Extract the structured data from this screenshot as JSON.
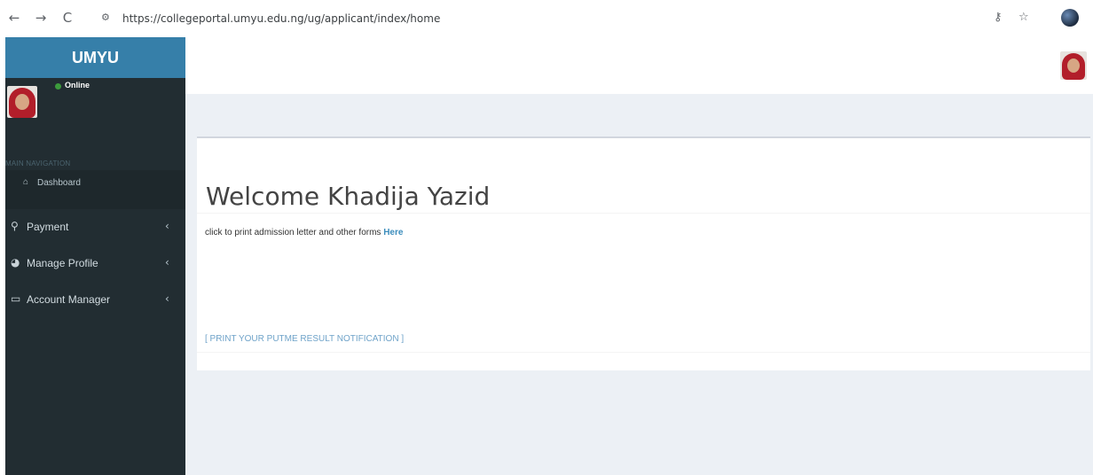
{
  "browser": {
    "url": "https://collegeportal.umyu.edu.ng/ug/applicant/index/home",
    "back_icon": "←",
    "forward_icon": "→",
    "reload_icon": "C",
    "site_info_icon": "⚙",
    "key_icon": "⚷",
    "star_icon": "☆"
  },
  "sidebar": {
    "logo": "UMYU",
    "status": "Online",
    "nav_header": "MAIN NAVIGATION",
    "dashboard": {
      "icon": "⌂",
      "label": "Dashboard"
    },
    "items": [
      {
        "icon": "⚲",
        "label": "Payment",
        "arrow": "‹"
      },
      {
        "icon": "◕",
        "label": "Manage Profile",
        "arrow": "‹"
      },
      {
        "icon": "▭",
        "label": "Account Manager",
        "arrow": "‹"
      }
    ]
  },
  "main": {
    "welcome": "Welcome Khadija Yazid",
    "print_text": "click to print admission letter and other forms",
    "print_link": "Here",
    "putme_link": "[ PRINT YOUR PUTME RESULT NOTIFICATION ]"
  },
  "colors": {
    "logo_bg": "#367fa9",
    "sidebar_bg": "#222d32",
    "content_bg": "#ecf0f5",
    "link": "#3c8dbc"
  }
}
